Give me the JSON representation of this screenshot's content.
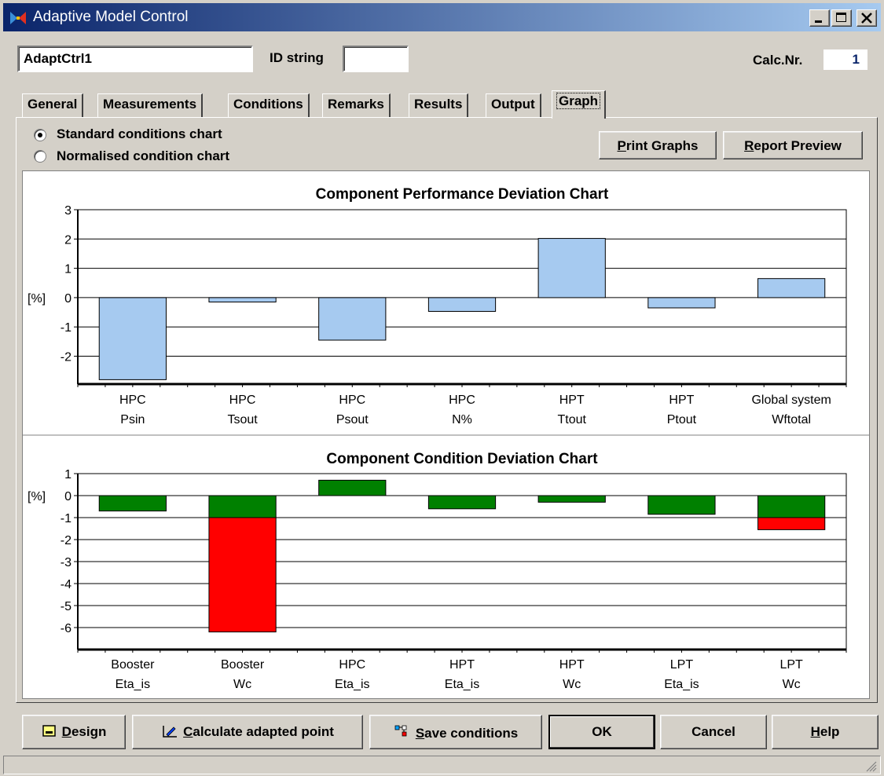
{
  "window": {
    "title": "Adaptive Model Control"
  },
  "header": {
    "model_name_value": "AdaptCtrl1",
    "id_string_label": "ID string",
    "id_string_value": "",
    "calc_nr_label": "Calc.Nr.",
    "calc_nr_value": "1"
  },
  "tabs": [
    {
      "label": "General"
    },
    {
      "label": "Measurements"
    },
    {
      "label": "Conditions"
    },
    {
      "label": "Remarks"
    },
    {
      "label": "Results"
    },
    {
      "label": "Output"
    },
    {
      "label": "Graph",
      "active": true
    }
  ],
  "graph_panel": {
    "radio_standard_label": "Standard conditions chart",
    "radio_normalised_label": "Normalised condition chart",
    "selected_radio": "standard",
    "print_graphs_label": "Print Graphs",
    "report_preview_label": "Report Preview"
  },
  "colors": {
    "performance_bar": "#a6caf0",
    "condition_green": "#008000",
    "condition_red": "#ff0000",
    "titlebar_start": "#0a246a",
    "titlebar_end": "#a6caf0"
  },
  "chart_data": [
    {
      "type": "bar",
      "title": "Component Performance Deviation Chart",
      "ylabel": "[%]",
      "ylim": [
        -2.95,
        3
      ],
      "yticks": [
        3,
        2,
        1,
        0,
        -1,
        -2
      ],
      "grid": true,
      "categories": [
        [
          "HPC",
          "Psin"
        ],
        [
          "HPC",
          "Tsout"
        ],
        [
          "HPC",
          "Psout"
        ],
        [
          "HPC",
          "N%"
        ],
        [
          "HPT",
          "Ttout"
        ],
        [
          "HPT",
          "Ptout"
        ],
        [
          "Global system",
          "Wftotal"
        ]
      ],
      "series": [
        {
          "values": [
            -2.8,
            -0.15,
            -1.45,
            -0.47,
            2.02,
            -0.35,
            0.65
          ],
          "color": "#a6caf0"
        }
      ]
    },
    {
      "type": "bar",
      "title": "Component Condition Deviation Chart",
      "ylabel": "[%]",
      "ylim": [
        -7,
        1
      ],
      "yticks": [
        1,
        0,
        -1,
        -2,
        -3,
        -4,
        -5,
        -6
      ],
      "grid": true,
      "categories": [
        [
          "Booster",
          "Eta_is"
        ],
        [
          "Booster",
          "Wc"
        ],
        [
          "HPC",
          "Eta_is"
        ],
        [
          "HPT",
          "Eta_is"
        ],
        [
          "HPT",
          "Wc"
        ],
        [
          "LPT",
          "Eta_is"
        ],
        [
          "LPT",
          "Wc"
        ]
      ],
      "series": [
        {
          "values": [
            -0.7,
            -1.0,
            0.7,
            -0.6,
            -0.3,
            -0.85,
            -1.0
          ],
          "color": "#008000"
        },
        {
          "values": [
            0,
            -5.2,
            0,
            0,
            0,
            0,
            -0.55
          ],
          "color": "#ff0000"
        }
      ]
    }
  ],
  "buttons": {
    "design": "Design",
    "calculate": "Calculate adapted point",
    "save_conditions": "Save conditions",
    "ok": "OK",
    "cancel": "Cancel",
    "help": "Help"
  }
}
